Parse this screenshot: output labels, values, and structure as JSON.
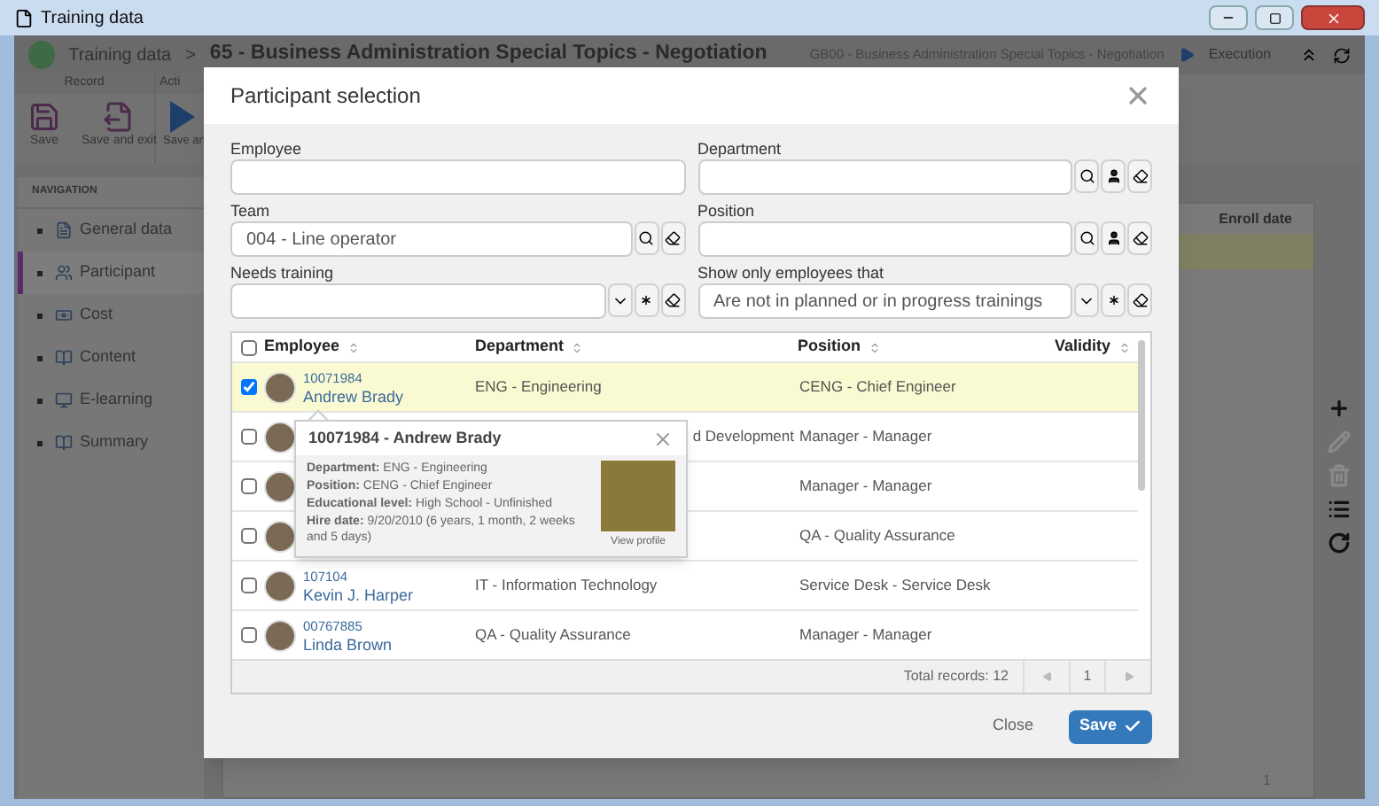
{
  "window": {
    "title": "Training data"
  },
  "header": {
    "breadcrumb": "Training data",
    "separator": ">",
    "title": "65 - Business Administration Special Topics - Negotiation",
    "code": "GB00 - Business Administration Special Topics - Negotiation",
    "status": "Execution"
  },
  "ribbon": {
    "groups": [
      {
        "label": "Record",
        "buttons": [
          {
            "kind": "save",
            "lines": [
              "Save"
            ]
          },
          {
            "kind": "save_exit",
            "lines": [
              "Save and exit"
            ]
          }
        ]
      },
      {
        "label": "Acti",
        "buttons": [
          {
            "kind": "play",
            "lines": [
              "Save an"
            ]
          }
        ]
      }
    ]
  },
  "navigation": {
    "title": "NAVIGATION",
    "items": [
      {
        "label": "General data",
        "selected": false
      },
      {
        "label": "Participant",
        "selected": true
      },
      {
        "label": "Cost",
        "selected": false
      },
      {
        "label": "Content",
        "selected": false
      },
      {
        "label": "E-learning",
        "selected": false
      },
      {
        "label": "Summary",
        "selected": false
      }
    ]
  },
  "background_table": {
    "column": "Enroll date",
    "rows": [
      {
        "selected": true
      }
    ],
    "page": "1"
  },
  "toolbar": [
    {
      "kind": "add",
      "disabled": false
    },
    {
      "kind": "edit",
      "disabled": true
    },
    {
      "kind": "delete",
      "disabled": true
    },
    {
      "kind": "list",
      "disabled": false
    },
    {
      "kind": "refresh",
      "disabled": false
    }
  ],
  "dialog": {
    "title": "Participant selection",
    "fields": [
      {
        "label": "Employee",
        "kind": "text"
      },
      {
        "label": "Department",
        "kind": "lookup_user"
      },
      {
        "label": "Team",
        "kind": "lookup",
        "value": "004 - Line operator"
      },
      {
        "label": "Position",
        "kind": "lookup_user"
      },
      {
        "label": "Needs training",
        "kind": "select"
      },
      {
        "label": "Show only employees that",
        "kind": "select",
        "value": "Are not in planned or in progress trainings"
      }
    ],
    "table": {
      "all_selected": false,
      "columns": [
        "Employee",
        "Department",
        "Position",
        "Validity"
      ],
      "rows": [
        {
          "id": "10071984",
          "name": "Andrew Brady",
          "department": "ENG - Engineering",
          "position": "CENG - Chief Engineer",
          "selected": true,
          "checked": true
        },
        {
          "department": "d Development",
          "position": "Manager - Manager",
          "selected": false,
          "checked": false
        },
        {
          "position": "Manager - Manager",
          "selected": false,
          "checked": false
        },
        {
          "position": "QA - Quality Assurance",
          "selected": false,
          "checked": false
        },
        {
          "id": "107104",
          "name": "Kevin J. Harper",
          "department": "IT - Information Technology",
          "position": "Service Desk - Service Desk",
          "selected": false,
          "checked": false
        },
        {
          "id": "00767885",
          "name": "Linda Brown",
          "department": "QA - Quality Assurance",
          "position": "Manager - Manager",
          "selected": false,
          "checked": false
        }
      ],
      "total": "Total records: 12",
      "page": "1"
    },
    "popover": {
      "title": "10071984 - Andrew Brady",
      "details": [
        "**Department:** ENG - Engineering",
        "**Position:** CENG - Chief Engineer",
        "**Educational level:** High School - Unfinished",
        "**Hire date:** 9/20/2010 (6 years, 1 month, 2 weeks and 5 days)"
      ],
      "link": "View profile"
    },
    "buttons": {
      "close": "Close",
      "save": "Save"
    }
  }
}
